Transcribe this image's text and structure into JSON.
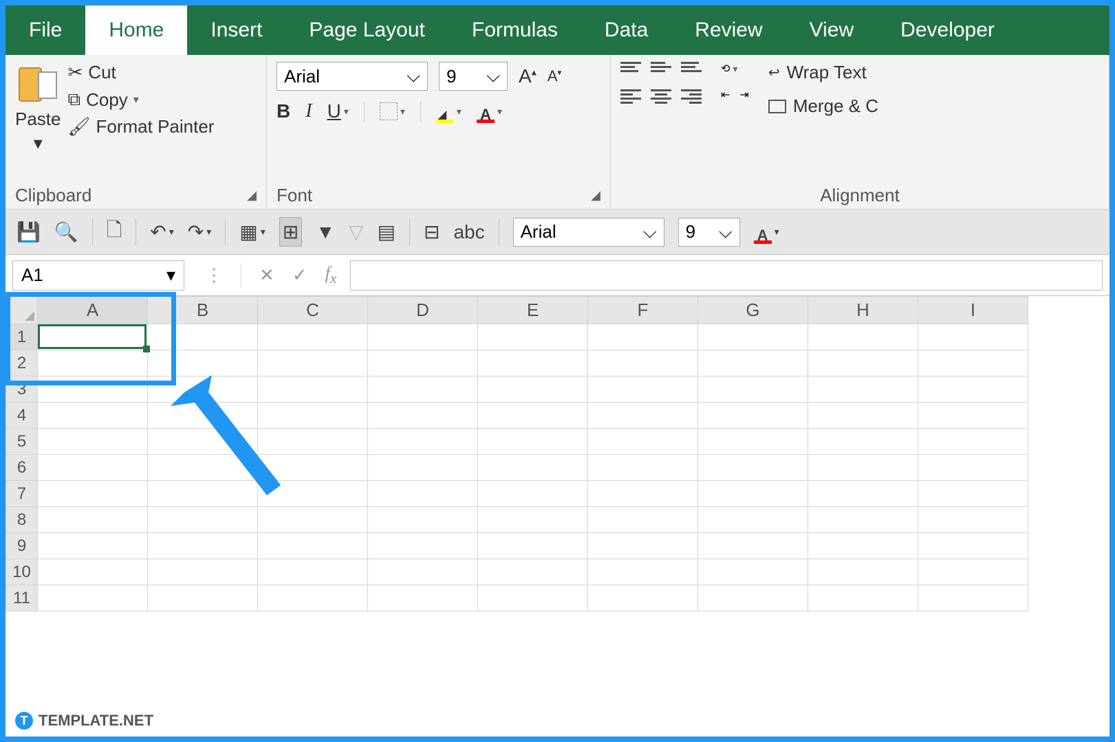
{
  "tabs": [
    "File",
    "Home",
    "Insert",
    "Page Layout",
    "Formulas",
    "Data",
    "Review",
    "View",
    "Developer"
  ],
  "active_tab": "Home",
  "clipboard": {
    "paste": "Paste",
    "cut": "Cut",
    "copy": "Copy",
    "format_painter": "Format Painter",
    "group_label": "Clipboard"
  },
  "font": {
    "name": "Arial",
    "size": "9",
    "group_label": "Font"
  },
  "alignment": {
    "wrap": "Wrap Text",
    "merge": "Merge & C",
    "group_label": "Alignment"
  },
  "qat": {
    "font_name": "Arial",
    "font_size": "9"
  },
  "namebox": "A1",
  "columns": [
    "A",
    "B",
    "C",
    "D",
    "E",
    "F",
    "G",
    "H",
    "I"
  ],
  "rows": [
    "1",
    "2",
    "3",
    "4",
    "5",
    "6",
    "7",
    "8",
    "9",
    "10",
    "11"
  ],
  "selected_cell": "A1",
  "watermark": "TEMPLATE.NET"
}
